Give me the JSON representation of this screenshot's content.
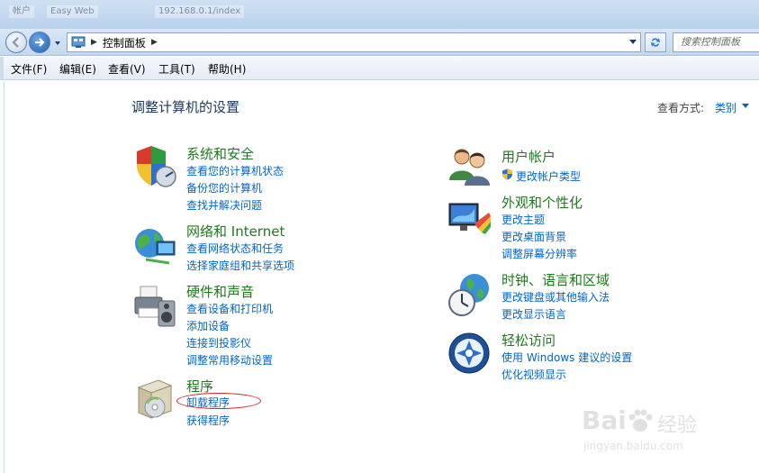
{
  "window": {
    "title_tabs": [
      "帐户",
      "Easy Web",
      "192.168.0.1/index"
    ]
  },
  "address_bar": {
    "crumbs": [
      "控制面板"
    ],
    "search_placeholder": "搜索控制面板"
  },
  "menu": {
    "items": [
      "文件(F)",
      "编辑(E)",
      "查看(V)",
      "工具(T)",
      "帮助(H)"
    ]
  },
  "main": {
    "title": "调整计算机的设置",
    "view_by_label": "查看方式:",
    "view_by_value": "类别"
  },
  "categories_left": [
    {
      "title": "系统和安全",
      "icon": "security-shield-icon",
      "links": [
        "查看您的计算机状态",
        "备份您的计算机",
        "查找并解决问题"
      ]
    },
    {
      "title": "网络和 Internet",
      "icon": "network-globe-icon",
      "links": [
        "查看网络状态和任务",
        "选择家庭组和共享选项"
      ]
    },
    {
      "title": "硬件和声音",
      "icon": "printer-speaker-icon",
      "links": [
        "查看设备和打印机",
        "添加设备",
        "连接到投影仪",
        "调整常用移动设置"
      ]
    },
    {
      "title": "程序",
      "icon": "programs-box-icon",
      "links": [
        "卸载程序",
        "获得程序"
      ]
    }
  ],
  "categories_right": [
    {
      "title": "用户帐户",
      "icon": "users-icon",
      "links": [
        "更改帐户类型"
      ]
    },
    {
      "title": "外观和个性化",
      "icon": "monitor-palette-icon",
      "links": [
        "更改主题",
        "更改桌面背景",
        "调整屏幕分辨率"
      ]
    },
    {
      "title": "时钟、语言和区域",
      "icon": "clock-globe-icon",
      "links": [
        "更改键盘或其他输入法",
        "更改显示语言"
      ]
    },
    {
      "title": "轻松访问",
      "icon": "ease-of-access-icon",
      "links": [
        "使用 Windows 建议的设置",
        "优化视频显示"
      ]
    }
  ],
  "watermark": {
    "brand": "Bai",
    "brand_suffix": "经验",
    "url": "jingyan.baidu.com"
  },
  "colors": {
    "category_title": "#1d7a1d",
    "link": "#0066cc",
    "page_title": "#1e395b",
    "highlight_ellipse": "#d2262c"
  }
}
